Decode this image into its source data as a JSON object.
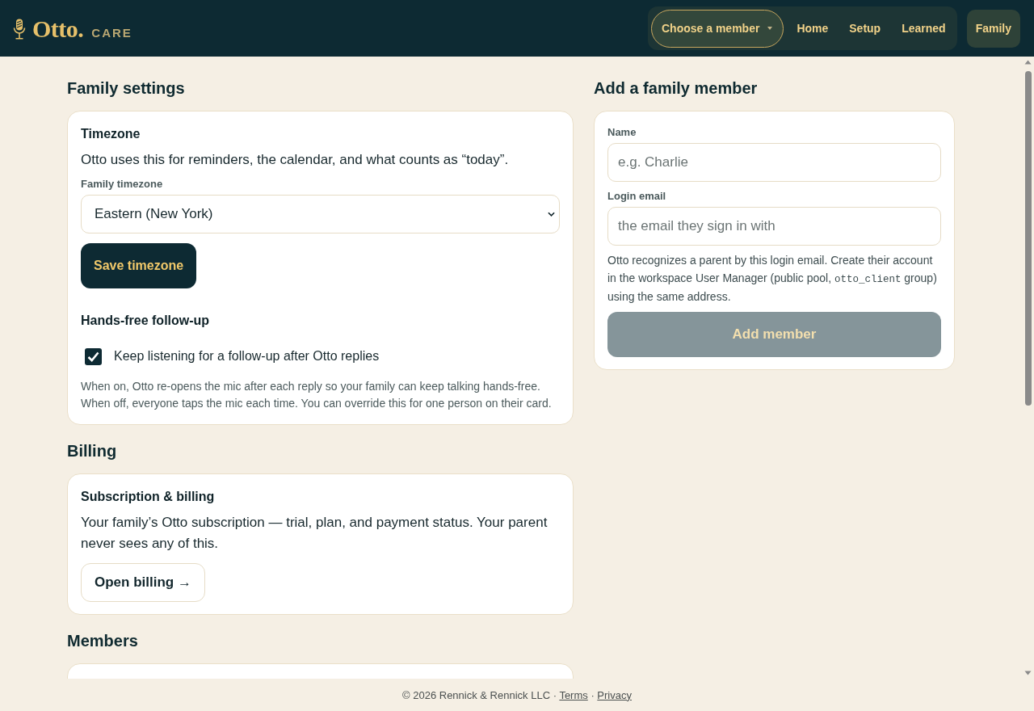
{
  "header": {
    "logo": {
      "wordmark": "Otto.",
      "tagline": "CARE"
    },
    "nav": {
      "member_picker": {
        "label": "Choose a member"
      },
      "links": [
        {
          "label": "Home",
          "selected": false
        },
        {
          "label": "Setup",
          "selected": false
        },
        {
          "label": "Learned",
          "selected": false
        }
      ],
      "family_link": {
        "label": "Family",
        "selected": true
      }
    }
  },
  "family_settings": {
    "heading": "Family settings",
    "timezone": {
      "title": "Timezone",
      "description": "Otto uses this for reminders, the calendar, and what counts as “today”.",
      "field_label": "Family timezone",
      "value": "Eastern (New York)",
      "save_button": "Save timezone"
    },
    "hands_free": {
      "title": "Hands-free follow-up",
      "checkbox": {
        "label": "Keep listening for a follow-up after Otto replies",
        "checked": true
      },
      "help": "When on, Otto re-opens the mic after each reply so your family can keep talking hands-free. When off, everyone taps the mic each time. You can override this for one person on their card."
    }
  },
  "billing": {
    "heading": "Billing",
    "title": "Subscription & billing",
    "description": "Your family’s Otto subscription — trial, plan, and payment status. Your parent never sees any of this.",
    "button": "Open billing →"
  },
  "members": {
    "heading": "Members"
  },
  "add_member": {
    "heading": "Add a family member",
    "fields": [
      {
        "label": "Name",
        "placeholder": "e.g. Charlie"
      },
      {
        "label": "Login email",
        "placeholder": "the email they sign in with"
      }
    ],
    "help": [
      {
        "kind": "text",
        "text": "Otto recognizes a parent by this login email. Create their account in the workspace User Manager (public pool, "
      },
      {
        "kind": "code",
        "text": "otto_client"
      },
      {
        "kind": "text",
        "text": " group) using the same address."
      }
    ],
    "button": {
      "label": "Add member",
      "disabled": true
    }
  },
  "footer": {
    "copyright": "© 2026 Rennick & Rennick LLC",
    "links": [
      {
        "separator": "·",
        "label": "Terms"
      },
      {
        "separator": "·",
        "label": "Privacy"
      }
    ]
  }
}
